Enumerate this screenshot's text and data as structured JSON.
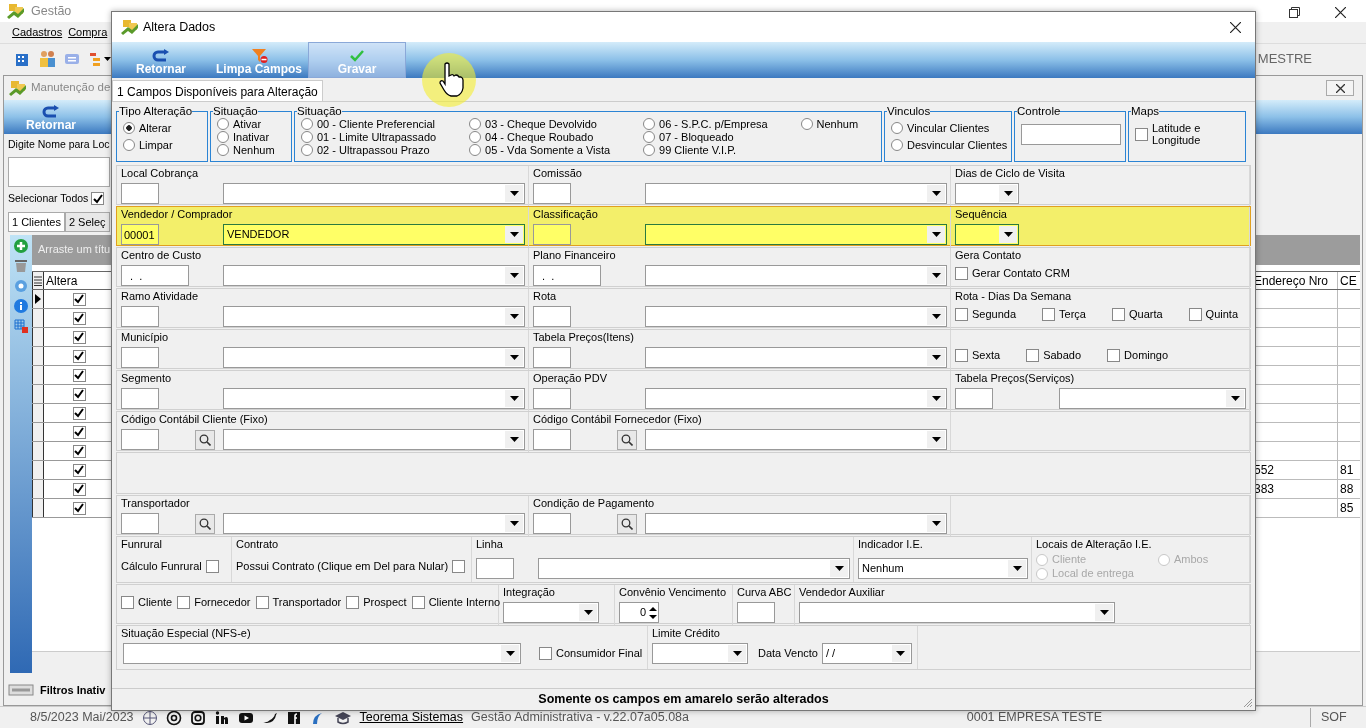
{
  "app": {
    "title": "Gestão",
    "menu": [
      "Cadastros",
      "Compra"
    ],
    "toolbar_label": "MESTRE",
    "child": {
      "title": "Manutenção de",
      "return_button": "Retornar",
      "search_label": "Digite Nome para Loc",
      "select_all": {
        "label": "Selecionar Todos",
        "checked": true
      },
      "tabs": [
        {
          "label": "1 Clientes",
          "selected": true
        },
        {
          "label": "2 Seleç",
          "selected": false
        }
      ],
      "group_panel": "Arraste um títu",
      "columns": [
        "Altera",
        "Endereço Nro",
        "CE"
      ],
      "rows": [
        {
          "current": true,
          "checked": true
        },
        {
          "current": false,
          "checked": true
        },
        {
          "current": false,
          "checked": true
        },
        {
          "current": false,
          "checked": true
        },
        {
          "current": false,
          "checked": true
        },
        {
          "current": false,
          "checked": true
        },
        {
          "current": false,
          "checked": true
        },
        {
          "current": false,
          "checked": true
        },
        {
          "current": false,
          "checked": true
        },
        {
          "current": false,
          "checked": true,
          "endereco_nro": "552",
          "ce": "81"
        },
        {
          "current": false,
          "checked": true,
          "endereco_nro": "383",
          "ce": "88"
        },
        {
          "current": false,
          "checked": true,
          "ce": "85"
        }
      ],
      "filter_status": "Filtros Inativ"
    },
    "status_bar": {
      "date": "8/5/2023 Mai/2023",
      "link": "Teorema Sistemas",
      "version": "Gestão Administrativa - v.22.07a05.08a",
      "company": "0001 EMPRESA TESTE",
      "user": "SOF"
    }
  },
  "dialog": {
    "title": "Altera Dados",
    "toolbar": [
      {
        "label": "Retornar",
        "hovered": false
      },
      {
        "label": "Limpa Campos",
        "hovered": false
      },
      {
        "label": "Gravar",
        "hovered": true
      }
    ],
    "tab": {
      "label": "1 Campos Disponíveis para Alteração",
      "selected": true
    },
    "groups": [
      {
        "title": "Tipo Alteração",
        "kind": "radios",
        "options": [
          {
            "label": "Alterar",
            "selected": true
          },
          {
            "label": "Limpar",
            "selected": false
          }
        ]
      },
      {
        "title": "Situação",
        "kind": "radios-tight",
        "options": [
          {
            "label": "Ativar",
            "selected": false
          },
          {
            "label": "Inativar",
            "selected": false
          },
          {
            "label": "Nenhum",
            "selected": false
          }
        ]
      },
      {
        "title": "Situação",
        "kind": "radio-grid",
        "options": [
          {
            "label": "00 - Cliente Preferencial",
            "selected": false
          },
          {
            "label": "01 - Limite Ultrapassado",
            "selected": false
          },
          {
            "label": "02 - Ultrapassou Prazo",
            "selected": false
          },
          {
            "label": "03 - Cheque Devolvido",
            "selected": false
          },
          {
            "label": "04 - Cheque Roubado",
            "selected": false
          },
          {
            "label": "05 - Vda Somente a Vista",
            "selected": false
          },
          {
            "label": "06 - S.P.C. p/Empresa",
            "selected": false
          },
          {
            "label": "07 - Bloqueado",
            "selected": false
          },
          {
            "label": "99 Cliente V.I.P.",
            "selected": false
          },
          {
            "label": "Nenhum",
            "selected": false
          }
        ]
      },
      {
        "title": "Vinculos",
        "kind": "radios",
        "options": [
          {
            "label": "Vincular Clientes",
            "selected": false
          },
          {
            "label": "Desvincular Clientes",
            "selected": false
          }
        ]
      },
      {
        "title": "Controle",
        "kind": "field"
      },
      {
        "title": "Maps",
        "kind": "checks",
        "options": [
          {
            "label": "Latitude e Longitude",
            "checked": false
          }
        ]
      }
    ],
    "rows": [
      {
        "kind": "standard",
        "highlighted": false,
        "cells": [
          {
            "label": "Local Cobrança",
            "controls": [
              {
                "kind": "code"
              },
              {
                "kind": "select"
              }
            ]
          },
          {
            "label": "Comissão",
            "controls": [
              {
                "kind": "code"
              },
              {
                "kind": "select"
              }
            ]
          },
          {
            "label": "Dias de Ciclo de Visita",
            "controls": [
              {
                "kind": "small-select"
              }
            ]
          }
        ]
      },
      {
        "kind": "standard",
        "highlighted": true,
        "cells": [
          {
            "label": "Vendedor / Comprador",
            "controls": [
              {
                "kind": "code",
                "value": "00001"
              },
              {
                "kind": "select",
                "value": "VENDEDOR"
              }
            ]
          },
          {
            "label": "Classificação",
            "controls": [
              {
                "kind": "code"
              },
              {
                "kind": "select"
              }
            ]
          },
          {
            "label": "Sequência",
            "controls": [
              {
                "kind": "small-select"
              }
            ]
          }
        ]
      },
      {
        "kind": "standard",
        "highlighted": false,
        "cells": [
          {
            "label": "Centro de Custo",
            "controls": [
              {
                "kind": "mask",
                "value": "  .  ."
              },
              {
                "kind": "select"
              }
            ]
          },
          {
            "label": "Plano Financeiro",
            "controls": [
              {
                "kind": "mask",
                "value": "  .  ."
              },
              {
                "kind": "select"
              }
            ]
          },
          {
            "label": "Gera Contato",
            "controls": [
              {
                "kind": "check",
                "label": "Gerar Contato CRM",
                "checked": false
              }
            ]
          }
        ]
      },
      {
        "kind": "standard",
        "highlighted": false,
        "cells": [
          {
            "label": "Ramo Atividade",
            "controls": [
              {
                "kind": "code"
              },
              {
                "kind": "select"
              }
            ]
          },
          {
            "label": "Rota",
            "controls": [
              {
                "kind": "code"
              },
              {
                "kind": "select"
              }
            ]
          },
          {
            "label": "Rota - Dias Da Semana",
            "controls": [
              {
                "kind": "check",
                "label": "Segunda",
                "checked": false
              },
              {
                "kind": "check",
                "label": "Terça",
                "checked": false
              },
              {
                "kind": "check",
                "label": "Quarta",
                "checked": false
              },
              {
                "kind": "check",
                "label": "Quinta",
                "checked": false
              }
            ]
          }
        ]
      },
      {
        "kind": "standard",
        "highlighted": false,
        "cells": [
          {
            "label": "Município",
            "controls": [
              {
                "kind": "code"
              },
              {
                "kind": "select"
              }
            ]
          },
          {
            "label": "Tabela Preços(Itens)",
            "controls": [
              {
                "kind": "code"
              },
              {
                "kind": "select"
              }
            ]
          },
          {
            "controls": [
              {
                "kind": "check",
                "label": "Sexta",
                "checked": false
              },
              {
                "kind": "check",
                "label": "Sabado",
                "checked": false
              },
              {
                "kind": "check",
                "label": "Domingo",
                "checked": false
              }
            ]
          }
        ]
      },
      {
        "kind": "standard",
        "highlighted": false,
        "cells": [
          {
            "label": "Segmento",
            "controls": [
              {
                "kind": "code"
              },
              {
                "kind": "select"
              }
            ]
          },
          {
            "label": "Operação PDV",
            "controls": [
              {
                "kind": "code"
              },
              {
                "kind": "select"
              }
            ]
          },
          {
            "label": "Tabela Preços(Serviços)",
            "controls": [
              {
                "kind": "code"
              },
              {
                "kind": "select"
              }
            ]
          }
        ]
      },
      {
        "kind": "standard",
        "highlighted": false,
        "cells": [
          {
            "label": "Código Contábil Cliente (Fixo)",
            "controls": [
              {
                "kind": "code"
              },
              {
                "kind": "lookup"
              },
              {
                "kind": "select"
              }
            ]
          },
          {
            "label": "Código Contábil Fornecedor (Fixo)",
            "controls": [
              {
                "kind": "code"
              },
              {
                "kind": "lookup"
              },
              {
                "kind": "select"
              }
            ]
          },
          {}
        ]
      },
      {
        "kind": "spacer",
        "highlighted": false,
        "cells": []
      },
      {
        "kind": "standard",
        "highlighted": false,
        "cells": [
          {
            "label": "Transportador",
            "controls": [
              {
                "kind": "code"
              },
              {
                "kind": "lookup"
              },
              {
                "kind": "select"
              }
            ]
          },
          {
            "label": "Condição de Pagamento",
            "controls": [
              {
                "kind": "code"
              },
              {
                "kind": "lookup"
              },
              {
                "kind": "select"
              }
            ]
          },
          {}
        ]
      },
      {
        "kind": "ie",
        "highlighted": false,
        "cells": [
          {
            "label": "Funrural",
            "controls": [
              {
                "kind": "check-right",
                "label": "Cálculo Funrural",
                "checked": false
              }
            ]
          },
          {
            "label": "Contrato",
            "controls": [
              {
                "kind": "check-right",
                "label": "Possui Contrato (Clique em Del para Nular)",
                "checked": false
              }
            ]
          },
          {
            "label": "Linha",
            "controls": [
              {
                "kind": "code"
              },
              {
                "kind": "select"
              }
            ]
          },
          {
            "label": "Indicador I.E.",
            "controls": [
              {
                "kind": "select",
                "value": "Nenhum"
              }
            ]
          },
          {
            "label": "Locais de Alteração I.E.",
            "controls": [
              {
                "kind": "radio",
                "label": "Cliente",
                "selected": false,
                "disabled": true
              },
              {
                "kind": "radio",
                "label": "Ambos",
                "selected": false,
                "disabled": true
              },
              {
                "kind": "radio",
                "label": "Local de entrega",
                "selected": false,
                "disabled": true
              }
            ]
          }
        ]
      },
      {
        "kind": "flags",
        "highlighted": false,
        "cells": [
          {
            "controls": [
              {
                "kind": "check",
                "label": "Cliente",
                "checked": false
              },
              {
                "kind": "check",
                "label": "Fornecedor",
                "checked": false
              },
              {
                "kind": "check",
                "label": "Transportador",
                "checked": false
              },
              {
                "kind": "check",
                "label": "Prospect",
                "checked": false
              },
              {
                "kind": "check",
                "label": "Cliente Interno",
                "checked": false
              }
            ]
          },
          {
            "label": "Integração",
            "controls": [
              {
                "kind": "short-select"
              }
            ]
          },
          {
            "label": "Convênio Vencimento",
            "controls": [
              {
                "kind": "spin",
                "value": "0"
              }
            ]
          },
          {
            "label": "Curva ABC",
            "controls": [
              {
                "kind": "code"
              }
            ]
          },
          {
            "label": "Vendedor Auxiliar",
            "controls": [
              {
                "kind": "wide-select"
              }
            ]
          }
        ]
      },
      {
        "kind": "nfse",
        "highlighted": false,
        "cells": [
          {
            "label": "Situação Especial (NFS-e)",
            "controls": [
              {
                "kind": "select"
              },
              {
                "kind": "check",
                "label": "Consumidor Final",
                "checked": false
              }
            ]
          },
          {
            "label": "Limite Crédito",
            "controls": [
              {
                "kind": "short-select"
              },
              {
                "kind": "text",
                "label": "Data Vencto"
              },
              {
                "kind": "date",
                "value": " /  /"
              }
            ]
          }
        ]
      }
    ],
    "footer": "Somente os campos em amarelo serão alterados"
  }
}
